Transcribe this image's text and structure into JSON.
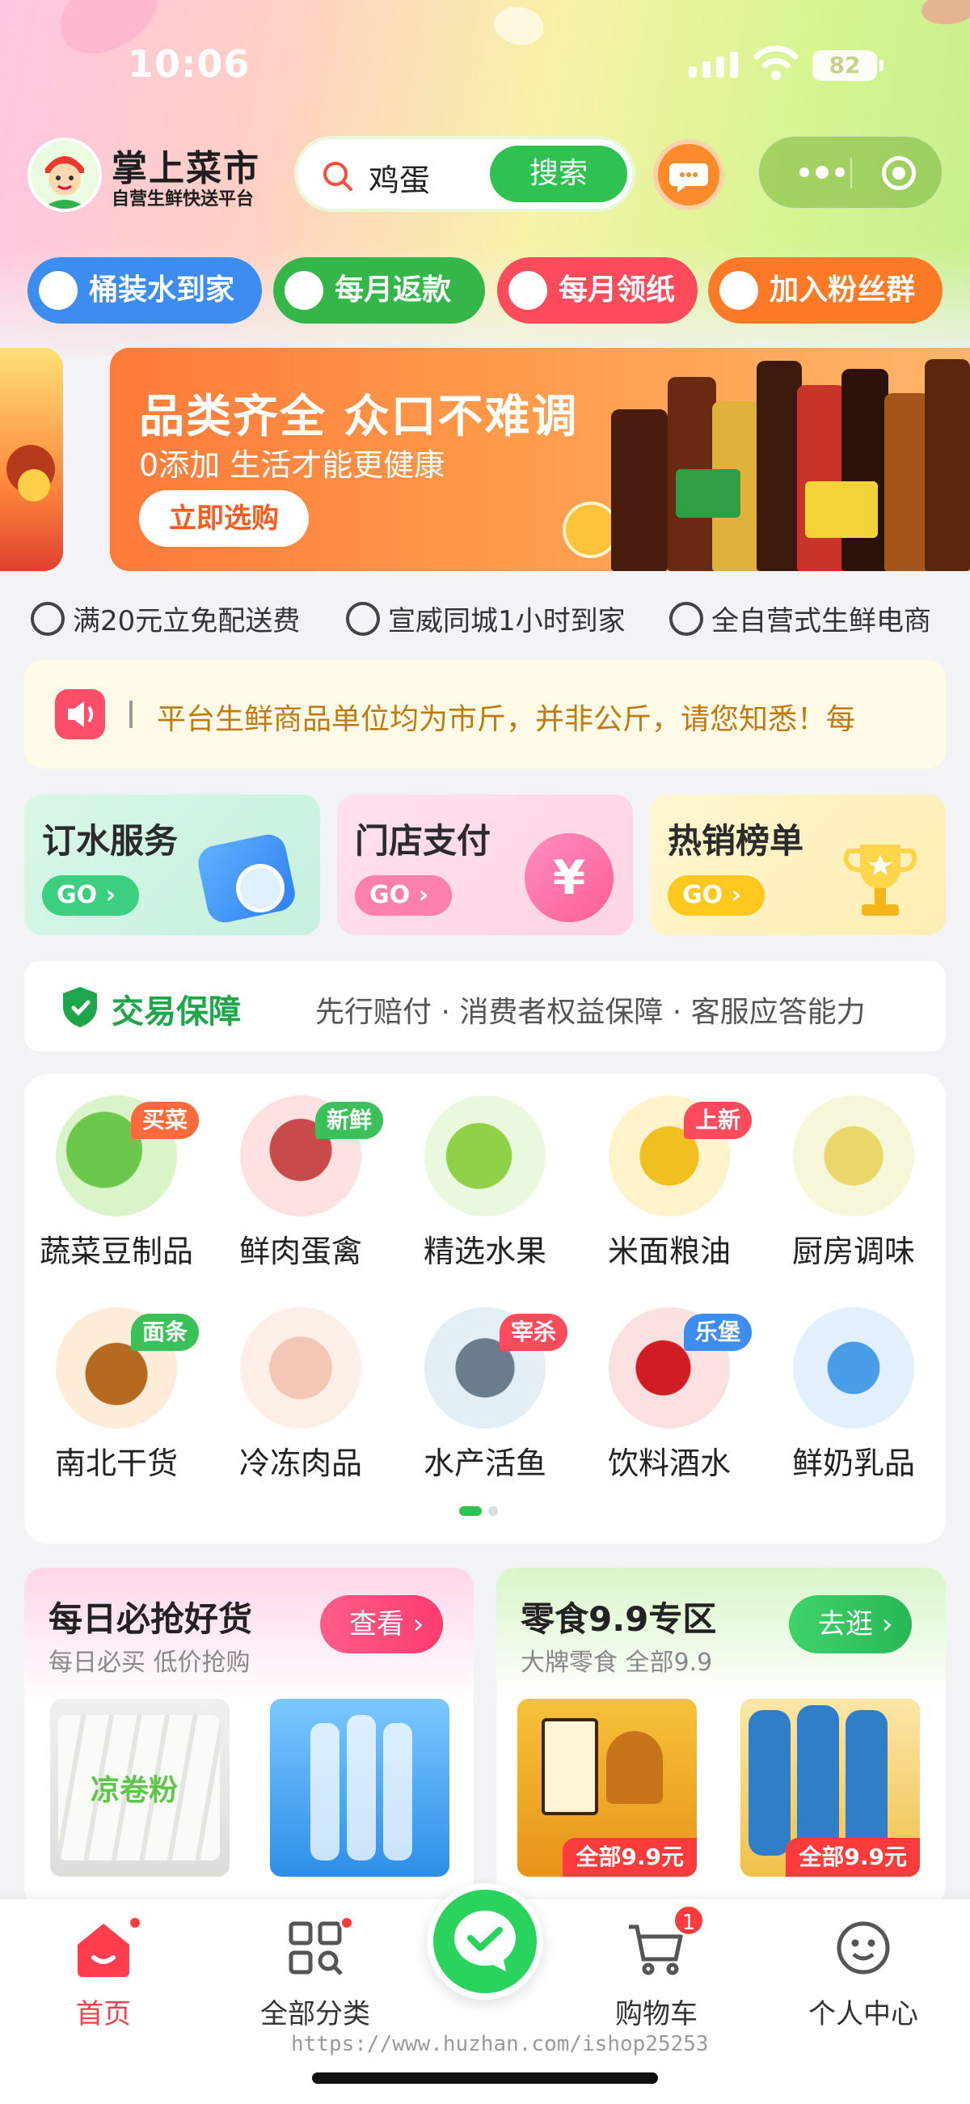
{
  "status_bar": {
    "time": "10:06",
    "battery": "82"
  },
  "header": {
    "brand_title": "掌上菜市",
    "brand_subtitle": "自营生鲜快送平台",
    "search_value": "鸡蛋",
    "search_button": "搜索"
  },
  "quick_pills": [
    {
      "label": "桶装水到家",
      "color": "#3d8cf0"
    },
    {
      "label": "每月返款",
      "color": "#34b649"
    },
    {
      "label": "每月领纸",
      "color": "#ff4b5c"
    },
    {
      "label": "加入粉丝群",
      "color": "#ff7a26"
    }
  ],
  "banner": {
    "title": "品类齐全 众口不难调",
    "subtitle": "0添加 生活才能更健康",
    "button": "立即选购"
  },
  "features": [
    "满20元立免配送费",
    "宣威同城1小时到家",
    "全自营式生鲜电商"
  ],
  "notice": {
    "text": "平台生鲜商品单位均为市斤，并非公斤，请您知悉！每"
  },
  "services": [
    {
      "title": "订水服务",
      "go": "GO"
    },
    {
      "title": "门店支付",
      "go": "GO"
    },
    {
      "title": "热销榜单",
      "go": "GO"
    }
  ],
  "guarantee": {
    "title": "交易保障",
    "text": "先行赔付 · 消费者权益保障 · 客服应答能力"
  },
  "categories": [
    {
      "label": "蔬菜豆制品",
      "badge": "买菜",
      "badge_color": "#ff6a3d"
    },
    {
      "label": "鲜肉蛋禽",
      "badge": "新鲜",
      "badge_color": "#3cc05a"
    },
    {
      "label": "精选水果",
      "badge": "",
      "badge_color": ""
    },
    {
      "label": "米面粮油",
      "badge": "上新",
      "badge_color": "#ff4b5c"
    },
    {
      "label": "厨房调味",
      "badge": "",
      "badge_color": ""
    },
    {
      "label": "南北干货",
      "badge": "面条",
      "badge_color": "#3cc05a"
    },
    {
      "label": "冷冻肉品",
      "badge": "",
      "badge_color": ""
    },
    {
      "label": "水产活鱼",
      "badge": "宰杀",
      "badge_color": "#ff4b5c"
    },
    {
      "label": "饮料酒水",
      "badge": "乐堡",
      "badge_color": "#3d8cf0"
    },
    {
      "label": "鲜奶乳品",
      "badge": "",
      "badge_color": ""
    }
  ],
  "promos": [
    {
      "title": "每日必抢好货",
      "subtitle": "每日必买 低价抢购",
      "button": "查看",
      "products": [
        {
          "label": "凉卷粉"
        },
        {
          "label": ""
        }
      ]
    },
    {
      "title": "零食9.9专区",
      "subtitle": "大牌零食 全部9.9",
      "button": "去逛",
      "products": [
        {
          "label": "全部9.9元"
        },
        {
          "label": "全部9.9元"
        }
      ]
    }
  ],
  "tabbar": {
    "home": "首页",
    "categories": "全部分类",
    "cart": "购物车",
    "cart_count": "1",
    "profile": "个人中心"
  },
  "watermark": "https://www.huzhan.com/ishop25253"
}
